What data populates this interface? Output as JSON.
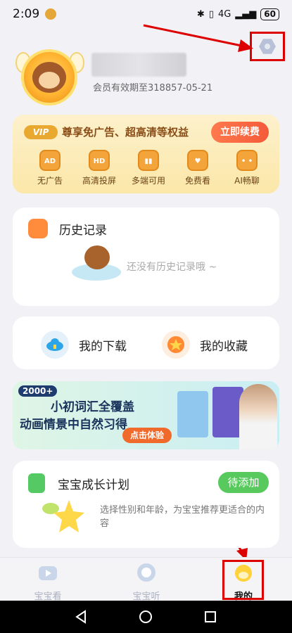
{
  "status": {
    "time": "2:09",
    "network": "4G",
    "battery": "60"
  },
  "profile": {
    "vip_expiry": "会员有效期至318857-05-21"
  },
  "vip": {
    "badge": "VIP",
    "title": "尊享免广告、超高清等权益",
    "renew": "立即续费",
    "perks": [
      {
        "icon": "AD",
        "label": "无广告"
      },
      {
        "icon": "HD",
        "label": "高清投屏"
      },
      {
        "icon": "",
        "label": "多端可用"
      },
      {
        "icon": "",
        "label": "免费看"
      },
      {
        "icon": "",
        "label": "AI畅聊"
      }
    ]
  },
  "history": {
    "title": "历史记录",
    "empty": "还没有历史记录哦 ~"
  },
  "shortcuts": {
    "downloads": "我的下载",
    "favorites": "我的收藏"
  },
  "banner": {
    "tag": "2000+",
    "line1": "小初词汇全覆盖",
    "line2": "动画情景中自然习得",
    "cta": "点击体验"
  },
  "growth": {
    "title": "宝宝成长计划",
    "action": "待添加",
    "desc": "选择性别和年龄，为宝宝推荐更适合的内容"
  },
  "tabs": {
    "watch": "宝宝看",
    "listen": "宝宝听",
    "me": "我的"
  },
  "colors": {
    "accent_orange": "#f35a3a",
    "green": "#58c95d",
    "highlight_red": "#dd0000"
  }
}
